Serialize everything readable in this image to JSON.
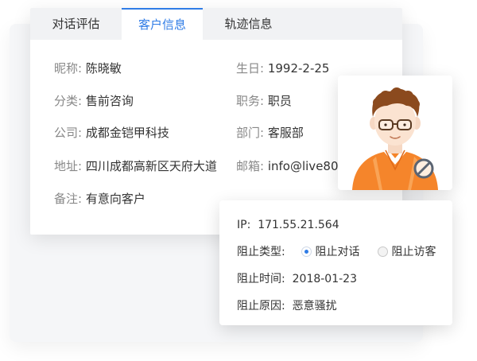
{
  "tabs": [
    {
      "label": "对话评估",
      "active": false
    },
    {
      "label": "客户信息",
      "active": true
    },
    {
      "label": "轨迹信息",
      "active": false
    }
  ],
  "customer": {
    "nickname": {
      "label": "昵称:",
      "value": "陈晓敏"
    },
    "birthday": {
      "label": "生日:",
      "value": "1992-2-25"
    },
    "category": {
      "label": "分类:",
      "value": "售前咨询"
    },
    "position": {
      "label": "职务:",
      "value": "职员"
    },
    "company": {
      "label": "公司:",
      "value": "成都金铠甲科技"
    },
    "department": {
      "label": "部门:",
      "value": "客服部"
    },
    "address": {
      "label": "地址:",
      "value": "四川成都高新区天府大道"
    },
    "email": {
      "label": "邮箱:",
      "value": "info@live80"
    },
    "remark": {
      "label": "备注:",
      "value": "有意向客户"
    }
  },
  "block": {
    "ip": {
      "label": "IP:",
      "value": "171.55.21.564"
    },
    "type": {
      "label": "阻止类型:",
      "options": [
        "阻止对话",
        "阻止访客"
      ],
      "selected": "阻止对话"
    },
    "time": {
      "label": "阻止时间:",
      "value": "2018-01-23"
    },
    "reason": {
      "label": "阻止原因:",
      "value": "恶意骚扰"
    }
  },
  "colors": {
    "accent": "#2f7ce6",
    "label": "#888888",
    "text": "#333333",
    "avatar_shirt": "#f5852b",
    "avatar_hair": "#8b4a1e"
  },
  "icons": {
    "avatar": "male-user-avatar-illustration",
    "blocked": "blocked-icon"
  }
}
